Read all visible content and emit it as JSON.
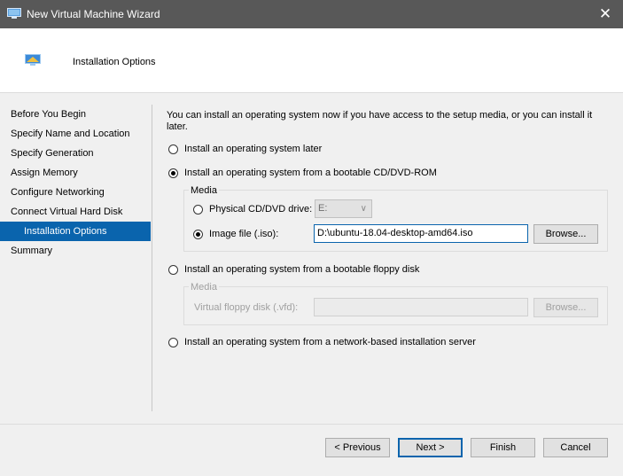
{
  "window": {
    "title": "New Virtual Machine Wizard",
    "close_glyph": "✕"
  },
  "header": {
    "title": "Installation Options"
  },
  "nav": {
    "items": [
      {
        "label": "Before You Begin"
      },
      {
        "label": "Specify Name and Location"
      },
      {
        "label": "Specify Generation"
      },
      {
        "label": "Assign Memory"
      },
      {
        "label": "Configure Networking"
      },
      {
        "label": "Connect Virtual Hard Disk"
      },
      {
        "label": "Installation Options",
        "active": true
      },
      {
        "label": "Summary"
      }
    ]
  },
  "main": {
    "description": "You can install an operating system now if you have access to the setup media, or you can install it later.",
    "opt_later": "Install an operating system later",
    "opt_cd": "Install an operating system from a bootable CD/DVD-ROM",
    "media_legend": "Media",
    "physical_label": "Physical CD/DVD drive:",
    "physical_value": "E:",
    "image_label": "Image file (.iso):",
    "image_value": "D:\\ubuntu-18.04-desktop-amd64.iso",
    "browse_label": "Browse...",
    "opt_floppy": "Install an operating system from a bootable floppy disk",
    "floppy_media_legend": "Media",
    "floppy_label": "Virtual floppy disk (.vfd):",
    "floppy_value": "",
    "floppy_browse_label": "Browse...",
    "opt_network": "Install an operating system from a network-based installation server"
  },
  "footer": {
    "previous": "< Previous",
    "next": "Next >",
    "finish": "Finish",
    "cancel": "Cancel"
  },
  "colors": {
    "titlebar": "#585858",
    "selection": "#0a64ad",
    "background": "#f0f0f0"
  }
}
